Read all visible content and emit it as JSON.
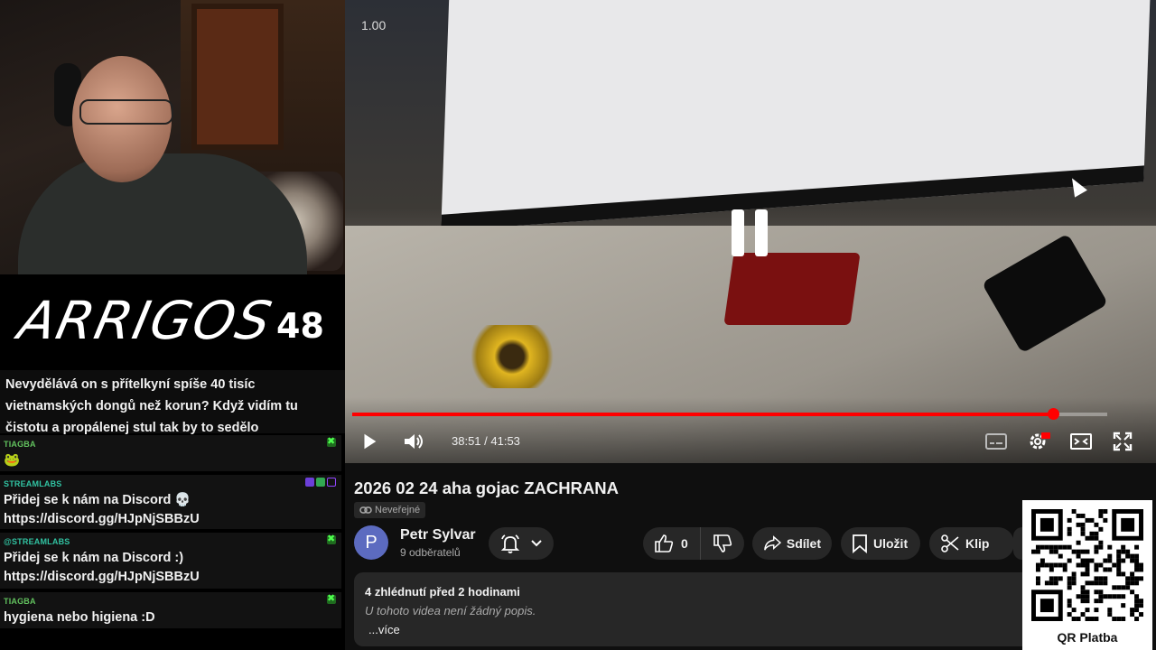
{
  "stream": {
    "brand": "ARRIGOS",
    "counter": "48",
    "highlight_message": "Nevydělává on s přítelkyní spíše 40 tisíc vietnamských dongů než korun? Když vidím tu čistotu a propálenej stul tak by to sedělo",
    "chat": [
      {
        "user": "TIAGBA",
        "user_color": "#62c15e",
        "text": "🐸"
      },
      {
        "user": "STREAMLABS",
        "user_color": "#31c3a2",
        "text": "Přidej se k nám na Discord 💀 https://discord.gg/HJpNjSBBzU"
      },
      {
        "user": "@STREAMLABS",
        "user_color": "#31c3a2",
        "text": "Přidej se k nám na Discord :) https://discord.gg/HJpNjSBBzU"
      },
      {
        "user": "TIAGBA",
        "user_color": "#62c15e",
        "text": "hygiena nebo higiena :D"
      }
    ]
  },
  "player": {
    "speed": "1.00",
    "time_display": "38:51 / 41:53",
    "progress": 0.928,
    "accent": "#ff0000"
  },
  "video": {
    "title": "2026 02 24 aha gojac ZACHRANA",
    "visibility": "Neveřejné",
    "channel": {
      "initial": "P",
      "name": "Petr Sylvar",
      "subscribers": "9 odběratelů"
    },
    "likes": "0",
    "actions": {
      "share": "Sdílet",
      "save": "Uložit",
      "clip": "Klip"
    },
    "description": {
      "meta": "4 zhlédnutí  před 2 hodinami",
      "text": "U tohoto videa není žádný popis.",
      "more": "...více"
    }
  },
  "qr": {
    "label": "QR Platba"
  }
}
